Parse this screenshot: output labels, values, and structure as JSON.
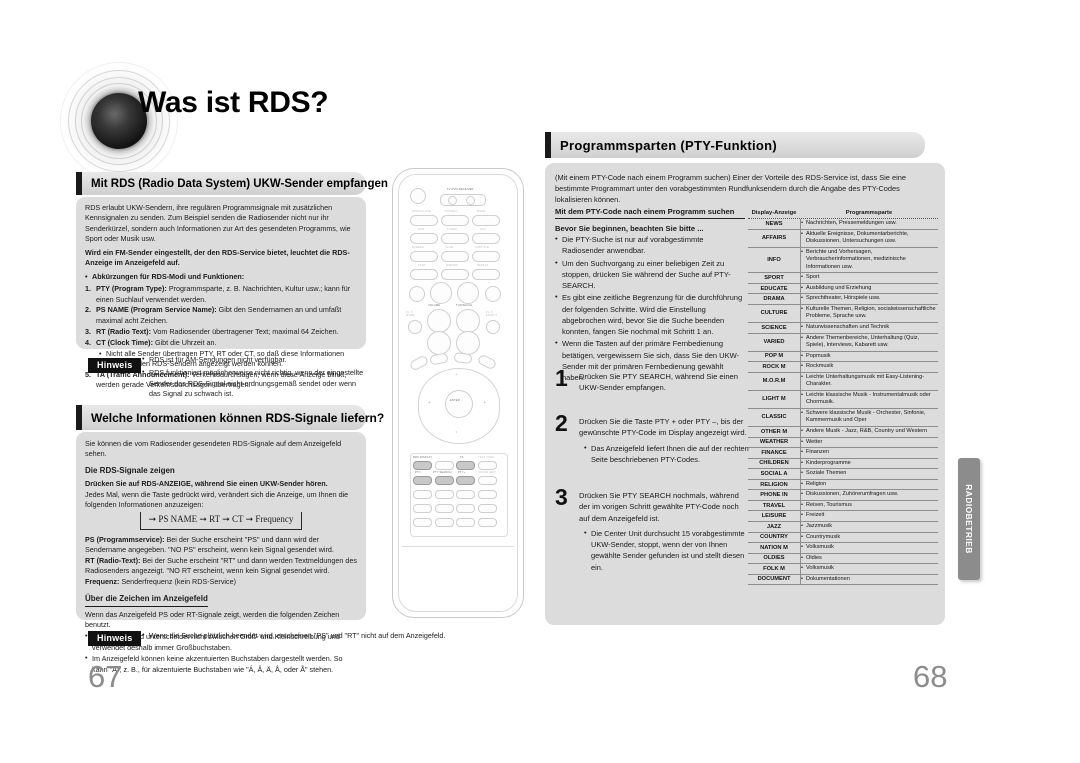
{
  "document": {
    "title": "Was ist RDS?",
    "page_left": "67",
    "page_right": "68",
    "side_tab": "RADIOBETRIEB"
  },
  "left_page": {
    "section1": {
      "heading": "Mit RDS (Radio Data System) UKW-Sender empfangen",
      "intro": "RDS erlaubt UKW-Sendern, ihre regulären Programmsignale mit zusätzlichen Kennsignalen zu senden. Zum Beispiel senden die Radiosender nicht nur ihr Senderkürzel, sondern auch Informationen zur Art des gesendeten Programms, wie Sport oder Musik usw.",
      "bold_note": "Wird ein FM-Sender eingestellt, der den RDS-Service bietet, leuchtet die RDS-Anzeige im Anzeigefeld auf.",
      "list_title": "Abkürzungen für RDS-Modi und Funktionen:",
      "items": [
        {
          "n": "1.",
          "term": "PTY (Program Type):",
          "text": " Programmsparte, z. B. Nachrichten, Kultur usw.; kann für einen Suchlauf verwendet werden."
        },
        {
          "n": "2.",
          "term": "PS NAME (Program Service Name):",
          "text": " Gibt den Sendernamen an und umfaßt maximal acht Zeichen."
        },
        {
          "n": "3.",
          "term": "RT (Radio Text):",
          "text": " Vom Radiosender übertragener Text; maximal 64 Zeichen."
        },
        {
          "n": "4.",
          "term": "CT (Clock Time):",
          "text": " Gibt die Uhrzeit an."
        }
      ],
      "sub_note": "Nicht alle Sender übertragen PTY, RT oder CT, so daß diese Informationen nicht bei allen RDS-Sendern angezeigt werden können.",
      "item5": {
        "n": "5.",
        "term": "TA (Traffic Announcement):",
        "text": " Verkehrsdurchsagen; wenn diese Anzeige blinkt, werden gerade Verkehrsdurchsagen übertragen."
      },
      "hinweis_label": "Hinweis",
      "hinweis_items": [
        "RDS ist für AM-Sendungen nicht  verfügbar.",
        "RDS funktioniert möglicherweise nicht richtig, wenn der eingestellte Sender das RDS-Signal nicht ordnungsgemäß sendet oder wenn das Signal zu schwach ist."
      ]
    },
    "section2": {
      "heading": "Welche Informationen können RDS-Signale liefern?",
      "intro": "Sie können die vom Radiosender gesendeten RDS-Signale auf dem Anzeigefeld sehen.",
      "sub1": "Die RDS-Signale zeigen",
      "bold_line": "Drücken Sie auf RDS-ANZEIGE, während Sie einen UKW-Sender hören.",
      "line2": "Jedes Mal, wenn die Taste gedrückt wird, verändert sich die Anzeige, um Ihnen die folgenden Informationen anzuzeigen:",
      "flow": "➞ PS NAME ➞ RT ➞ CT ➞ Frequency",
      "defs": [
        {
          "term": "PS (Programmservice):",
          "text": " Bei der Suche erscheint \"PS\" und dann wird der Sendername angegeben. \"NO PS\" erscheint, wenn kein Signal gesendet wird."
        },
        {
          "term": "RT (Radio-Text):",
          "text": " Bei der Suche erscheint \"RT\" und dann werden Textmeldungen des Radiosenders angezeigt. \"NO RT erscheint, wenn kein Signal gesendet wird."
        },
        {
          "term": "Frequenz:",
          "text": " Senderfrequenz (kein RDS-Service)"
        }
      ],
      "sub2": "Über die Zeichen im Anzeigefeld",
      "line3": "Wenn das Anzeigefeld PS oder RT-Signale zeigt, werden die folgenden Zeichen benutzt.",
      "bullets": [
        "Das Anzeigefeld unterscheidet nicht zwischen Groß- und Kleinschreibung und verwendet deshalb immer Großbuchstaben.",
        "Im Anzeigefeld können keine akzentuierten Buchstaben dargestellt werden. So kann \"A\", z. B., für akzentuierte Buchstaben wie \"Á, Â, Ä, Å, oder Ã\" stehen."
      ],
      "hinweis_label": "Hinweis",
      "hinweis_text": "Wenn die Suche plötzlich beendet wird, erscheinen \"PS\" und \"RT\" nicht auf dem Anzeigefeld."
    }
  },
  "right_page": {
    "heading": "Programmsparten (PTY-Funktion)",
    "intro": "(Mit einem PTY-Code nach einem Programm suchen) Einer der Vorteile des RDS-Service ist, dass Sie eine bestimmte Programmart unter den vorabgestimmten Rundfunksendern durch die Angabe des PTY-Codes lokalisieren können.",
    "sub_heading": "Mit dem PTY-Code nach einem Programm suchen",
    "before_title": "Bevor Sie beginnen, beachten Sie bitte ...",
    "before_bullets": [
      "Die PTY-Suche ist nur auf vorabgestimmte Radiosender anwendbar.",
      "Um den Suchvorgang zu einer beliebigen Zeit zu stoppen, drücken Sie während der Suche auf PTY-SEARCH.",
      "Es gibt eine zeitliche Begrenzung für die durchführung der folgenden Schritte. Wird die Einstellung abgebrochen wird, bevor Sie die Suche beenden konnten, fangen Sie nochmal mit Schritt 1 an.",
      "Wenn die Tasten auf der primäre Fernbedienung betätigen, vergewissern Sie sich, dass Sie den UKW-Sender mit der primären Fernbedienung gewählt haben."
    ],
    "steps": [
      {
        "num": "1",
        "text": "Drücken Sie PTY SEARCH, während Sie einen UKW-Sender empfangen.",
        "bullets": []
      },
      {
        "num": "2",
        "text": "Drücken Sie die Taste PTY + oder PTY –, bis der gewünschte PTY-Code im Display angezeigt wird.",
        "bullets": [
          "Das Anzeigefeld liefert Ihnen die auf der rechten Seite beschriebenen PTY-Codes."
        ]
      },
      {
        "num": "3",
        "text": "Drücken Sie PTY SEARCH nochmals, während der im vorigen Schritt gewählte PTY-Code noch auf dem Anzeigefeld ist.",
        "bullets": [
          "Die Center Unit durchsucht 15 vorabgestimmte UKW-Sender, stoppt, wenn der von Ihnen gewählte Sender gefunden ist und stellt diesen ein."
        ]
      }
    ],
    "table": {
      "headers": [
        "Display-Anzeige",
        "Programmsparte"
      ],
      "rows": [
        {
          "code": "NEWS",
          "desc": "Nachrichten, Pressemeldungen usw."
        },
        {
          "code": "AFFAIRS",
          "desc": "Aktuelle Ereignisse, Dokumentarberichte, Diskussionen, Untersuchungen usw."
        },
        {
          "code": "INFO",
          "desc": "Berichte und Vorhersagen, Verbraucherinformationen, medizinische Informationen usw."
        },
        {
          "code": "SPORT",
          "desc": "Sport"
        },
        {
          "code": "EDUCATE",
          "desc": "Ausbildung und Erziehung"
        },
        {
          "code": "DRAMA",
          "desc": "Sprechtheater, Hörspiele usw."
        },
        {
          "code": "CULTURE",
          "desc": "Kulturelle Themen, Religion, socialwissenschaftliche Probleme, Sprache usw."
        },
        {
          "code": "SCIENCE",
          "desc": "Naturwissenschaften und Technik"
        },
        {
          "code": "VARIED",
          "desc": "Andere Themenbereiche, Unterhaltung (Quiz, Spiele), Interviews, Kabarett usw."
        },
        {
          "code": "POP M",
          "desc": "Popmusik"
        },
        {
          "code": "ROCK M",
          "desc": "Rockmusik"
        },
        {
          "code": "M.O.R.M",
          "desc": "Leichte Unterhaltungsmusik mit Easy-Listening-Charakter."
        },
        {
          "code": "LIGHT M",
          "desc": "Leichte klassische Musik -  Instrumentalmusik oder Chormusik."
        },
        {
          "code": "CLASSIC",
          "desc": "Schwere klassische Musik - Orchester, Sinfonie, Kammermusik und Oper"
        },
        {
          "code": "OTHER M",
          "desc": "Andere Musik - Jazz, R&B, Country und Western"
        },
        {
          "code": "WEATHER",
          "desc": "Wetter"
        },
        {
          "code": "FINANCE",
          "desc": "Finanzen"
        },
        {
          "code": "CHILDREN",
          "desc": "Kinderprogramme"
        },
        {
          "code": "SOCIAL A",
          "desc": "Soziale Themen"
        },
        {
          "code": "RELIGION",
          "desc": "Religion"
        },
        {
          "code": "PHONE IN",
          "desc": "Diskussionen, Zuhörerumfragen usw."
        },
        {
          "code": "TRAVEL",
          "desc": "Reisen, Tourismus"
        },
        {
          "code": "LEISURE",
          "desc": "Freizeit"
        },
        {
          "code": "JAZZ",
          "desc": "Jazzmusik"
        },
        {
          "code": "COUNTRY",
          "desc": "Countrymusik"
        },
        {
          "code": "NATION M",
          "desc": "Volksmusik"
        },
        {
          "code": "OLDIES",
          "desc": "Oldies"
        },
        {
          "code": "FOLK M",
          "desc": "Volksmusik"
        },
        {
          "code": "DOCUMENT",
          "desc": "Dokumentationen"
        }
      ]
    }
  },
  "remote": {
    "labels": [
      "TV",
      "DVD RECEIVER",
      "OPEN/CLOSE",
      "TV/VIDEO",
      "MODE",
      "DVD",
      "TUNER/BAND",
      "AUX",
      "SCREEN/SOUND",
      "SLOW/MODE",
      "SUBTITLE",
      "STEP",
      "DIMMER",
      "REPEAT",
      "VOLUME",
      "TUNING/CH",
      "P.L II MODE",
      "P.L II EFFECT",
      "ENTER",
      "RDS DISPLAY",
      "TA",
      "PTY-",
      "PTY SEARCH",
      "PTY+"
    ],
    "highlighted": [
      "RDS DISPLAY",
      "TA",
      "PTY-",
      "PTY SEARCH",
      "PTY+"
    ]
  }
}
